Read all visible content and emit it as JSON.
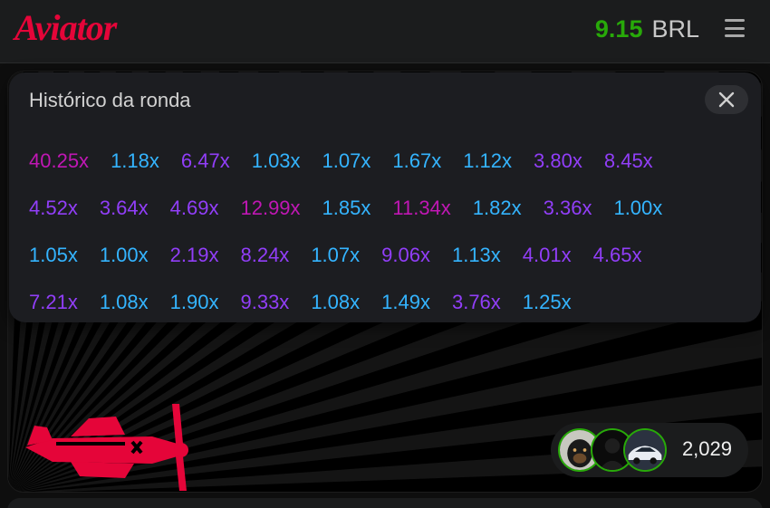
{
  "header": {
    "logo_text": "Aviator",
    "balance_amount": "9.15",
    "balance_currency": "BRL",
    "menu_icon": "hamburger-menu-icon"
  },
  "history": {
    "title": "Histórico da ronda",
    "close_icon": "close-icon",
    "rows": [
      [
        {
          "text": "40.25x",
          "color": "pink"
        },
        {
          "text": "1.18x",
          "color": "blue"
        },
        {
          "text": "6.47x",
          "color": "purple"
        },
        {
          "text": "1.03x",
          "color": "blue"
        },
        {
          "text": "1.07x",
          "color": "blue"
        },
        {
          "text": "1.67x",
          "color": "blue"
        },
        {
          "text": "1.12x",
          "color": "blue"
        },
        {
          "text": "3.80x",
          "color": "purple"
        },
        {
          "text": "8.45x",
          "color": "purple"
        }
      ],
      [
        {
          "text": "4.52x",
          "color": "purple"
        },
        {
          "text": "3.64x",
          "color": "purple"
        },
        {
          "text": "4.69x",
          "color": "purple"
        },
        {
          "text": "12.99x",
          "color": "pink"
        },
        {
          "text": "1.85x",
          "color": "blue"
        },
        {
          "text": "11.34x",
          "color": "pink"
        },
        {
          "text": "1.82x",
          "color": "blue"
        },
        {
          "text": "3.36x",
          "color": "purple"
        },
        {
          "text": "1.00x",
          "color": "blue"
        }
      ],
      [
        {
          "text": "1.05x",
          "color": "blue"
        },
        {
          "text": "1.00x",
          "color": "blue"
        },
        {
          "text": "2.19x",
          "color": "purple"
        },
        {
          "text": "8.24x",
          "color": "purple"
        },
        {
          "text": "1.07x",
          "color": "blue"
        },
        {
          "text": "9.06x",
          "color": "purple"
        },
        {
          "text": "1.13x",
          "color": "blue"
        },
        {
          "text": "4.01x",
          "color": "purple"
        },
        {
          "text": "4.65x",
          "color": "purple"
        }
      ],
      [
        {
          "text": "7.21x",
          "color": "purple"
        },
        {
          "text": "1.08x",
          "color": "blue"
        },
        {
          "text": "1.90x",
          "color": "blue"
        },
        {
          "text": "9.33x",
          "color": "purple"
        },
        {
          "text": "1.08x",
          "color": "blue"
        },
        {
          "text": "1.49x",
          "color": "blue"
        },
        {
          "text": "3.76x",
          "color": "purple"
        },
        {
          "text": "1.25x",
          "color": "blue"
        }
      ]
    ]
  },
  "players": {
    "count": "2,029",
    "avatars": [
      "dog-avatar",
      "person-avatar",
      "car-avatar"
    ]
  },
  "colors": {
    "brand_red": "#e50539",
    "balance_green": "#28a909",
    "blue": "#34b4ff",
    "purple": "#913ef8",
    "pink": "#c017b4"
  },
  "game": {
    "plane_icon": "red-plane-icon"
  }
}
